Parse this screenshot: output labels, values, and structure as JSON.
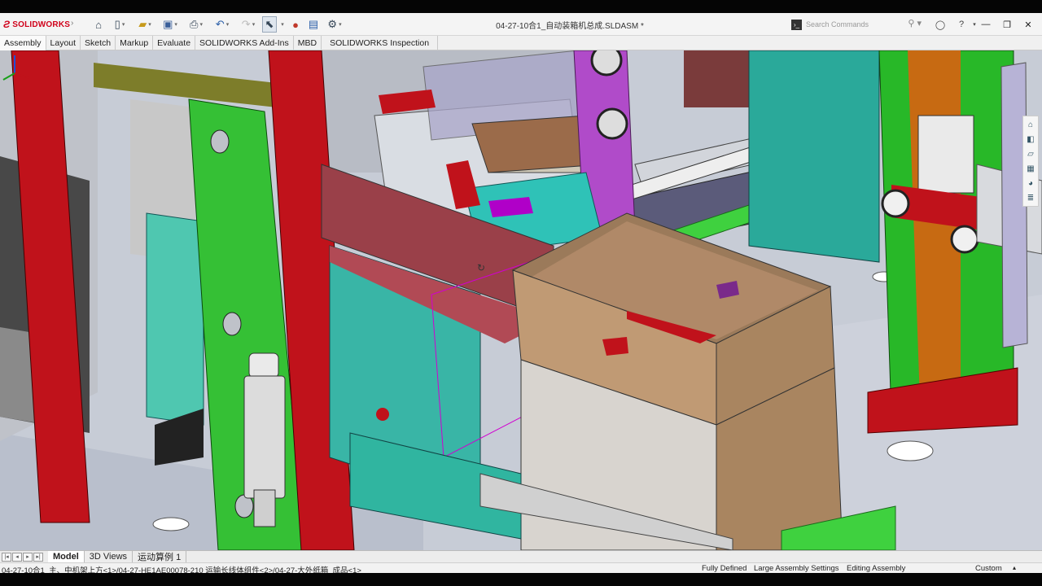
{
  "app": {
    "brand": "SOLIDWORKS",
    "doc_title": "04-27-10合1_自动装箱机总成.SLDASM *"
  },
  "search": {
    "placeholder": "Search Commands"
  },
  "command_tabs": [
    "Assembly",
    "Layout",
    "Sketch",
    "Markup",
    "Evaluate",
    "SOLIDWORKS Add-Ins",
    "MBD",
    "SOLIDWORKS Inspection"
  ],
  "bottom_tabs": [
    "Model",
    "3D Views",
    "运动算例 1"
  ],
  "status": {
    "path": "04-27-10合1_主、中机架上方<1>/04-27-HE1AE00078-210 运输长线体组件<2>/04-27-大外纸箱_成品<1>",
    "fully_defined": "Fully Defined",
    "large_assembly": "Large Assembly Settings",
    "editing": "Editing Assembly",
    "units": "Custom"
  },
  "colors": {
    "accent_red": "#d0021b",
    "viewport_bg": "#c7ccd6"
  },
  "icons": [
    "home-icon",
    "new-file-icon",
    "open-icon",
    "save-icon",
    "print-icon",
    "undo-icon",
    "select-icon",
    "traffic-light-icon",
    "file-properties-icon",
    "options-icon",
    "terminal-icon",
    "search-icon",
    "user-icon",
    "help-icon",
    "minimize-icon",
    "restore-icon",
    "close-icon"
  ]
}
